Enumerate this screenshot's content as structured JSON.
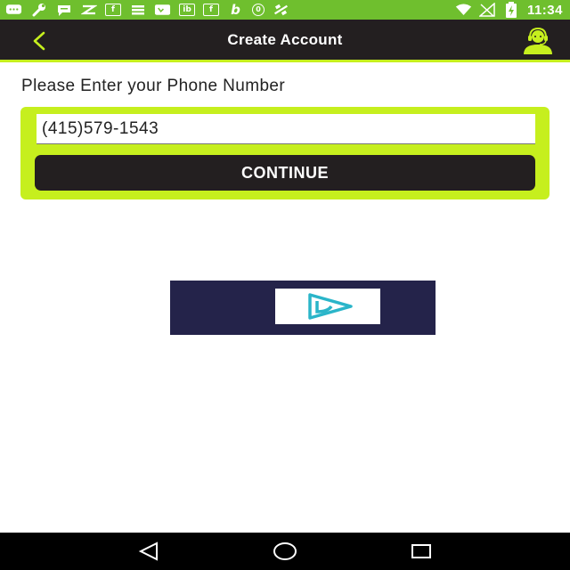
{
  "status_bar": {
    "time": "11:34",
    "notification_icons": [
      "message-icon",
      "wrench-icon",
      "chat-icon",
      "zedge-icon",
      "facebook-icon",
      "stack-icon",
      "voicemail-icon",
      "ib-icon",
      "facebook-icon",
      "b-icon",
      "circle-app-icon",
      "satellite-icon"
    ],
    "fb_glyph": "f",
    "ib_glyph": "ib",
    "b_glyph": "b",
    "o_glyph": "0"
  },
  "header": {
    "title": "Create Account",
    "back_glyph": "<"
  },
  "prompt": "Please Enter your Phone Number",
  "phone_input": {
    "value": "(415)579-1543"
  },
  "continue_label": "CONTINUE",
  "colors": {
    "accent": "#c6ef1e",
    "header_bg": "#231f20",
    "status_bar": "#6fbf2e",
    "ad_bg": "#24234a",
    "ad_play": "#2ab5c9"
  }
}
